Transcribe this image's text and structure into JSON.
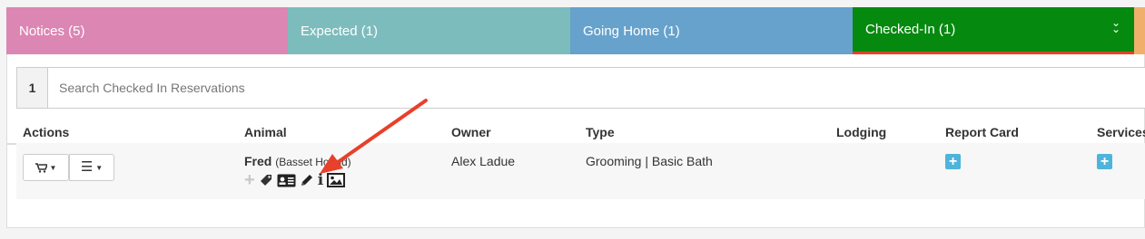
{
  "tabs": {
    "notices": "Notices (5)",
    "expected": "Expected (1)",
    "going_home": "Going Home (1)",
    "checked_in": "Checked-In (1)"
  },
  "search": {
    "count": "1",
    "placeholder": "Search Checked In Reservations"
  },
  "table": {
    "headers": {
      "actions": "Actions",
      "animal": "Animal",
      "owner": "Owner",
      "type": "Type",
      "lodging": "Lodging",
      "report_card": "Report Card",
      "services": "Services"
    },
    "rows": [
      {
        "animal_name": "Fred",
        "animal_breed": "(Basset Hound)",
        "owner": "Alex Ladue",
        "type": "Grooming | Basic Bath"
      }
    ]
  },
  "colors": {
    "notices": "#dc86b3",
    "expected": "#7dbcbd",
    "going_home": "#66a2cc",
    "checked_in": "#06890f",
    "annotation_arrow": "#e8402b",
    "add_button": "#4fb4dc"
  },
  "icons": [
    "cart-icon",
    "menu-icon",
    "add-icon",
    "tag-icon",
    "id-card-icon",
    "pencil-icon",
    "info-icon",
    "image-icon",
    "chevron-double-down-icon",
    "plus-icon"
  ]
}
